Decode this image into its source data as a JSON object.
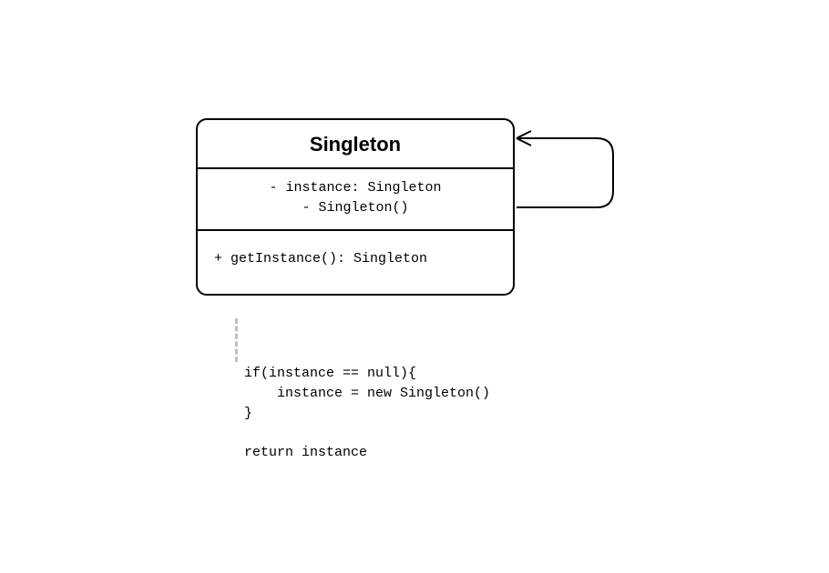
{
  "class": {
    "name": "Singleton",
    "attributes": [
      "- instance: Singleton",
      "-  Singleton()"
    ],
    "methods": [
      "+ getInstance(): Singleton"
    ]
  },
  "note": {
    "line1": "if(instance == null){",
    "line2": "    instance = new Singleton()",
    "line3": "}",
    "line4": "",
    "line5": "return instance"
  }
}
